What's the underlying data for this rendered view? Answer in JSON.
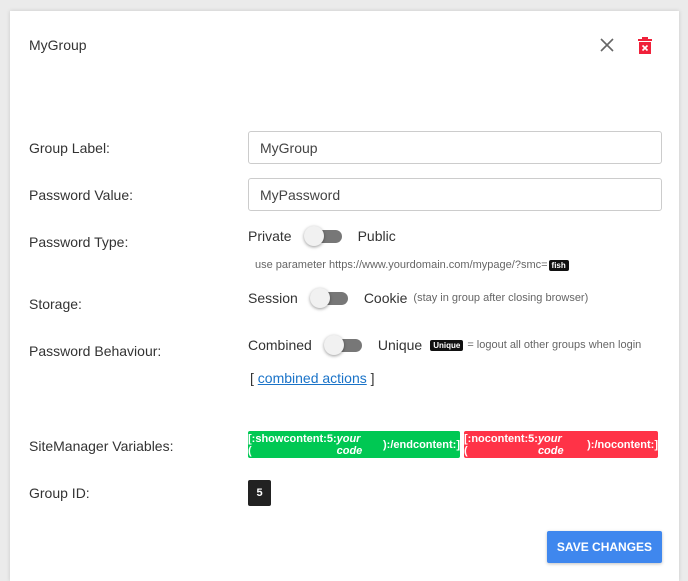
{
  "dialog": {
    "title": "MyGroup"
  },
  "fields": {
    "group_label": {
      "label": "Group Label:",
      "value": "MyGroup"
    },
    "password_value": {
      "label": "Password Value:",
      "value": "MyPassword"
    },
    "password_type": {
      "label": "Password Type:",
      "off": "Private",
      "on": "Public",
      "hint": "use parameter https://www.yourdomain.com/mypage/?smc=",
      "hint_badge": "fish"
    },
    "storage": {
      "label": "Storage:",
      "off": "Session",
      "on": "Cookie",
      "note": "(stay in group after closing browser)"
    },
    "behaviour": {
      "label": "Password Behaviour:",
      "off": "Combined",
      "on": "Unique",
      "badge": "Unique",
      "note": "= logout all other groups when login",
      "link_open": "[",
      "link": "combined actions",
      "link_close": "]"
    },
    "variables": {
      "label": "SiteManager Variables:",
      "show_pre": "[:showcontent:5:(",
      "show_em": "your code",
      "show_post": "):/endcontent:]",
      "no_pre": "[:nocontent:5:(",
      "no_em": "your code",
      "no_post": "):/nocontent:]"
    },
    "group_id": {
      "label": "Group ID:",
      "value": "5"
    }
  },
  "save_label": "SAVE CHANGES",
  "colors": {
    "green": "#00c853",
    "red": "#ff3347",
    "blue": "#3f87ee",
    "trash": "#f0213a"
  }
}
